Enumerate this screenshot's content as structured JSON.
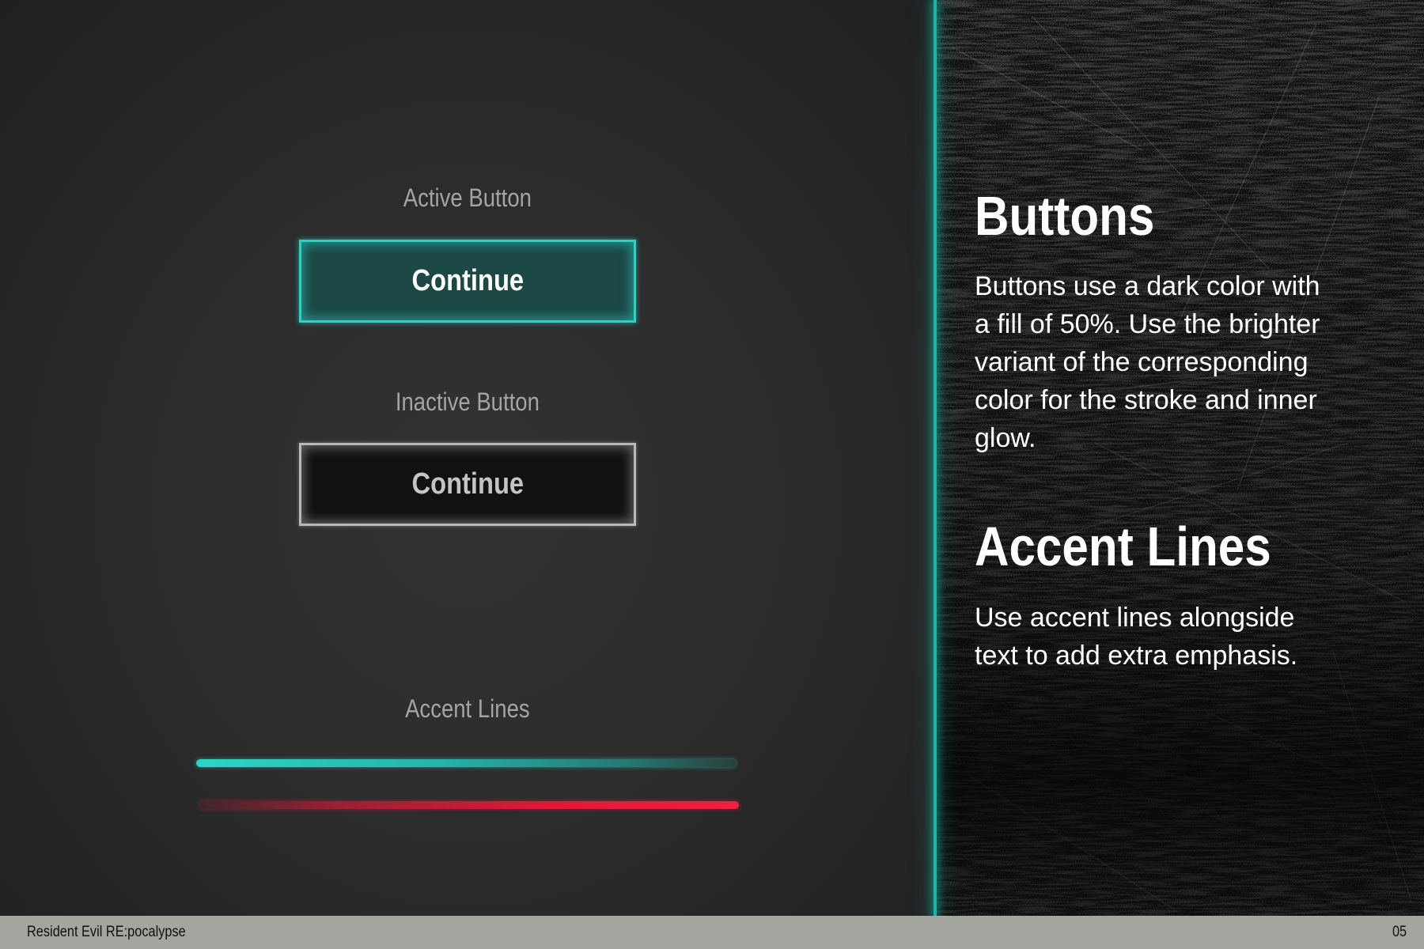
{
  "demo": {
    "active_label": "Active Button",
    "active_button_text": "Continue",
    "inactive_label": "Inactive Button",
    "inactive_button_text": "Continue",
    "accent_label": "Accent Lines"
  },
  "info": {
    "buttons_heading": "Buttons",
    "buttons_body": "Buttons use a dark color with a fill of 50%. Use the brighter variant of the corresponding color for the stroke and inner glow.",
    "accent_heading": "Accent Lines",
    "accent_body": "Use accent lines alongside text to add extra emphasis."
  },
  "footer": {
    "title": "Resident Evil RE:pocalypse",
    "page_number": "05"
  },
  "colors": {
    "teal_stroke": "#2ad3c4",
    "teal_fill": "#1c4846",
    "inactive_fill": "#111111",
    "inactive_stroke": "#b9b9b9",
    "red_accent": "#e21838",
    "footer_bg": "#a3a59f"
  }
}
